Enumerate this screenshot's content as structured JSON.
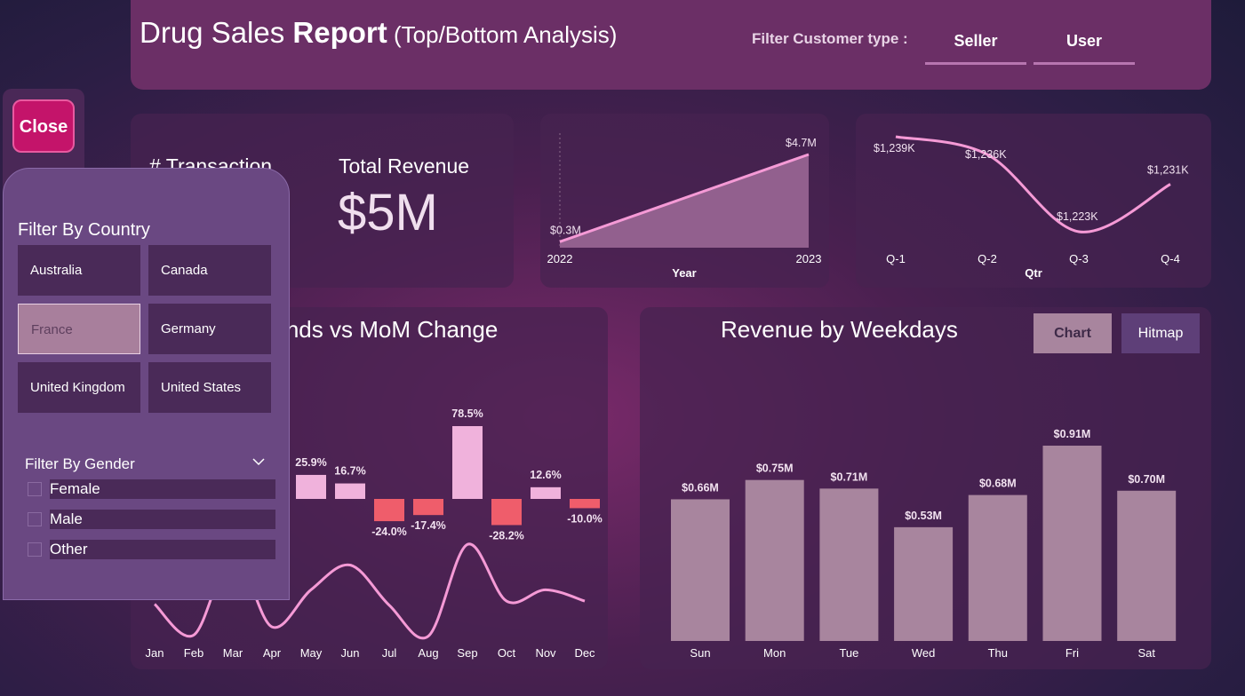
{
  "header": {
    "title_main": "Drug Sales ",
    "title_bold": "Report",
    "title_sub": " (Top/Bottom Analysis)",
    "filter_label": "Filter Customer type :",
    "customer_types": [
      "Seller",
      "User"
    ]
  },
  "close_button": "Close",
  "kpis": {
    "transaction_label": "# Transaction",
    "revenue_label": "Total Revenue",
    "revenue_value": "$5M"
  },
  "filter_pane": {
    "country_title": "Filter By Country",
    "countries": [
      "Australia",
      "Canada",
      "France",
      "Germany",
      "United Kingdom",
      "United States"
    ],
    "selected_country": "France",
    "gender_title": "Filter By Gender",
    "genders": [
      "Female",
      "Male",
      "Other"
    ]
  },
  "monthly": {
    "title": "Monthly Trends vs MoM Change",
    "visible_title": "nthly Trends vs MoM Change"
  },
  "weekdays": {
    "title": "Revenue by Weekdays",
    "toggle_chart": "Chart",
    "toggle_hitmap": "Hitmap"
  },
  "colors": {
    "accent_pink": "#f59ad6",
    "bar_positive": "#f0b2dc",
    "bar_negative": "#ef5d6b",
    "bar_weekday": "#a8859e",
    "close_button": "#c4146a"
  },
  "chart_data": [
    {
      "type": "area",
      "x": [
        "2022",
        "2023"
      ],
      "values": [
        0.3,
        4.7
      ],
      "data_labels": [
        "$0.3M",
        "$4.7M"
      ],
      "xlabel": "Year"
    },
    {
      "type": "line",
      "categories": [
        "Q-1",
        "Q-2",
        "Q-3",
        "Q-4"
      ],
      "values": [
        1239,
        1236,
        1223,
        1231
      ],
      "data_labels": [
        "$1,239K",
        "$1,236K",
        "$1,223K",
        "$1,231K"
      ],
      "xlabel": "Qtr"
    },
    {
      "type": "bar",
      "categories": [
        "Jan",
        "Feb",
        "Mar",
        "Apr",
        "May",
        "Jun",
        "Jul",
        "Aug",
        "Sep",
        "Oct",
        "Nov",
        "Dec"
      ],
      "mom_change": [
        null,
        null,
        null,
        null,
        25.9,
        16.7,
        -24.0,
        -17.4,
        78.5,
        -28.2,
        12.6,
        -10.0
      ],
      "data_labels": [
        "",
        "",
        "",
        "",
        "25.9%",
        "16.7%",
        "-24.0%",
        "-17.4%",
        "78.5%",
        "-28.2%",
        "12.6%",
        "-10.0%"
      ],
      "trend_line": [
        0.34,
        0.04,
        0.82,
        0.12,
        0.48,
        0.72,
        0.33,
        0.03,
        0.92,
        0.37,
        0.48,
        0.37
      ]
    },
    {
      "type": "bar",
      "categories": [
        "Sun",
        "Mon",
        "Tue",
        "Wed",
        "Thu",
        "Fri",
        "Sat"
      ],
      "values": [
        0.66,
        0.75,
        0.71,
        0.53,
        0.68,
        0.91,
        0.7
      ],
      "data_labels": [
        "$0.66M",
        "$0.75M",
        "$0.71M",
        "$0.53M",
        "$0.68M",
        "$0.91M",
        "$0.70M"
      ],
      "ylim": [
        0,
        0.91
      ]
    }
  ]
}
